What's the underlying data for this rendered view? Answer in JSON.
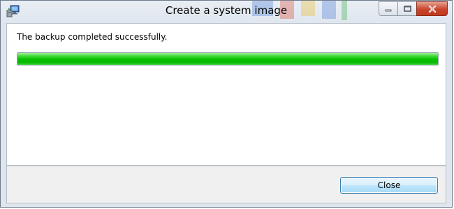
{
  "window": {
    "title": "Create a system image",
    "icon": "backup-computer-icon"
  },
  "controls": {
    "minimize_icon": "minimize-icon",
    "maximize_icon": "maximize-icon",
    "close_icon": "close-icon"
  },
  "main": {
    "message": "The backup completed successfully.",
    "progress": 1.0
  },
  "footer": {
    "close_label": "Close"
  },
  "colors": {
    "progress_fill": "#05c100",
    "close_button_border": "#3c7fb1",
    "window_chrome": "#dfe6ee"
  }
}
